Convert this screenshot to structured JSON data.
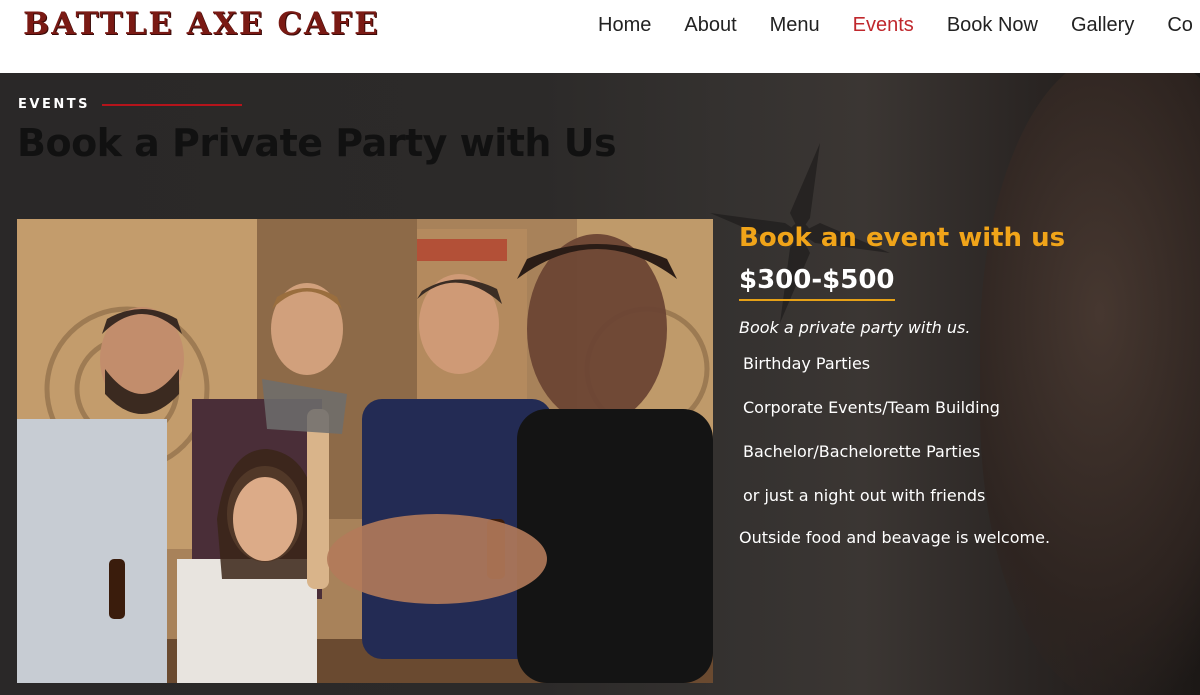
{
  "site": {
    "logo_text": "BATTLE AXE CAFE"
  },
  "nav": {
    "items": [
      {
        "label": "Home",
        "active": false
      },
      {
        "label": "About",
        "active": false
      },
      {
        "label": "Menu",
        "active": false
      },
      {
        "label": "Events",
        "active": true
      },
      {
        "label": "Book Now",
        "active": false
      },
      {
        "label": "Gallery",
        "active": false
      },
      {
        "label": "Co",
        "active": false
      }
    ]
  },
  "hero": {
    "eyebrow": "EVENTS",
    "title": "Book a Private Party with Us"
  },
  "offer": {
    "heading": "Book an event with us",
    "price": "$300-$500",
    "intro": "Book a private party with us.",
    "items": [
      "Birthday Parties",
      "Corporate Events/Team Building",
      "Bachelor/Bachelorette Parties",
      "or just a night out with friends"
    ],
    "note": "Outside food and beavage is welcome."
  },
  "colors": {
    "brand": "#7a1a14",
    "nav_active": "#c0282d",
    "accent_orange": "#f0a419",
    "eyebrow_line": "#b5141b",
    "hero_bg": "#2b2b2b"
  },
  "icons": [
    "throwing-star-icon"
  ]
}
